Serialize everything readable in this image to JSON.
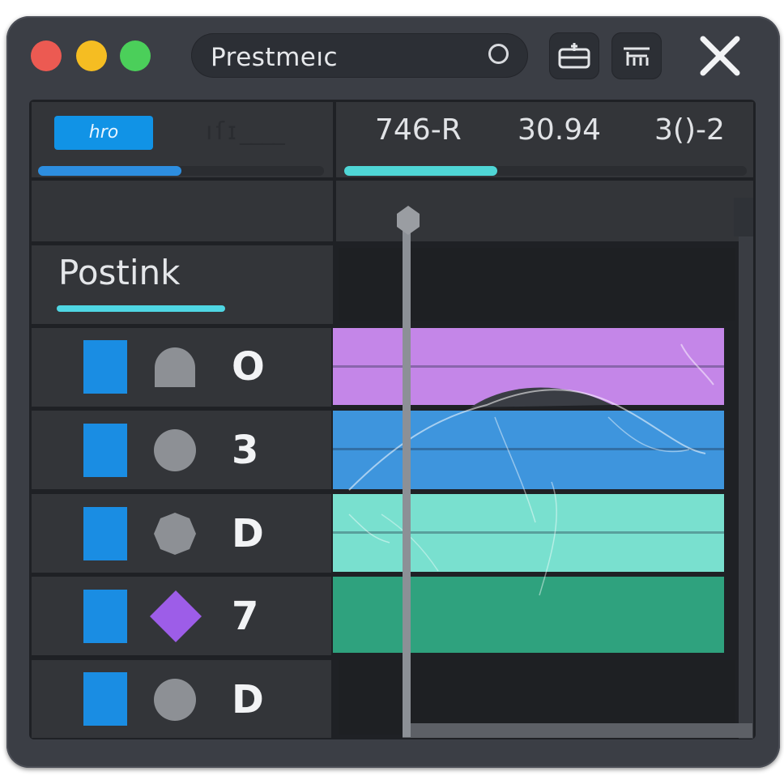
{
  "window": {
    "title": "Prestmeıc",
    "traffic_lights": [
      "close",
      "minimize",
      "maximize"
    ],
    "colors": {
      "red": "#ec5a52",
      "yellow": "#f5bd22",
      "green": "#4bcf5a"
    }
  },
  "toolbar": {
    "title_icon": "circle-icon",
    "button_a_icon": "export-icon",
    "button_b_icon": "settings-icon",
    "close_icon": "close-icon"
  },
  "header": {
    "chip_label": "hro",
    "ghost_label": "ıſɪ_ ̲ ̲ ̲",
    "left_progress": 0.5,
    "stats": [
      "746-R",
      "30.94",
      "3()-2"
    ],
    "right_progress": 0.38
  },
  "section": {
    "label": "Postink",
    "accent": "#4fd6e3"
  },
  "layers": [
    {
      "label": "O",
      "shape": "dome-icon",
      "band_color": "#c486e8"
    },
    {
      "label": "3",
      "shape": "circle-icon",
      "band_color": "#3e95dd"
    },
    {
      "label": "D",
      "shape": "circle-icon",
      "band_color": "#79e0cf"
    },
    {
      "label": "7",
      "shape": "diamond-icon",
      "band_color": "#2fa27e"
    },
    {
      "label": "D",
      "shape": "circle-icon",
      "band_color": null
    }
  ]
}
